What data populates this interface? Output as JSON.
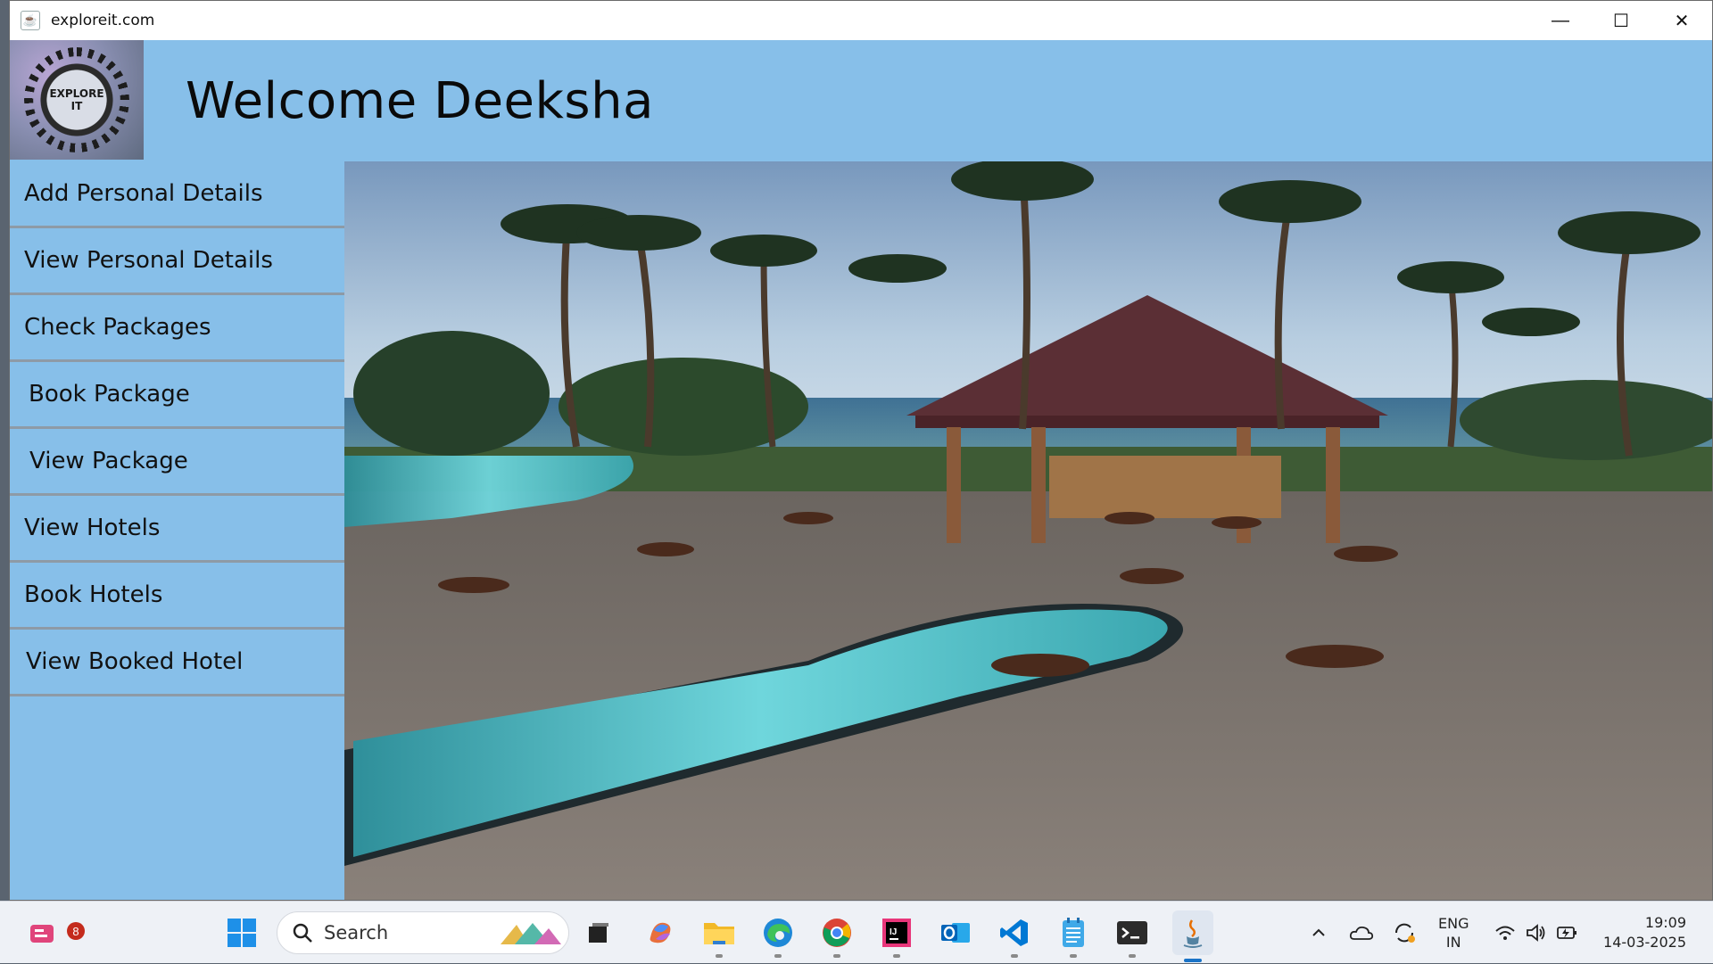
{
  "window": {
    "title": "exploreit.com",
    "minimize_glyph": "—",
    "maximize_glyph": "☐",
    "close_glyph": "✕"
  },
  "header": {
    "logo_text_line1": "EXPLORE",
    "logo_text_line2": "IT",
    "welcome": "Welcome Deeksha"
  },
  "sidebar": {
    "items": [
      {
        "label": "Add Personal Details"
      },
      {
        "label": "View Personal Details"
      },
      {
        "label": "Check Packages"
      },
      {
        "label": "Book Package"
      },
      {
        "label": "View Package"
      },
      {
        "label": "View Hotels"
      },
      {
        "label": "Book Hotels"
      },
      {
        "label": "View Booked Hotel"
      }
    ]
  },
  "hero": {
    "image": "beach-resort-pool-photo",
    "colors": {
      "sky": "#a8c2da",
      "sea": "#3f6f7d",
      "pool": "#5fd0d8",
      "roof": "#5b2f35"
    }
  },
  "taskbar": {
    "widgets_badge": "8",
    "search_placeholder": "Search",
    "apps": [
      "start-icon",
      "search-icon",
      "task-view-icon",
      "copilot-icon",
      "file-explorer-icon",
      "edge-icon",
      "chrome-icon",
      "intellij-icon",
      "outlook-icon",
      "vscode-icon",
      "notepad-icon",
      "terminal-icon",
      "java-icon"
    ],
    "language_line1": "ENG",
    "language_line2": "IN",
    "time": "19:09",
    "date": "14-03-2025"
  },
  "colors": {
    "app_background": "#87bfe9",
    "menu_divider": "#8e9aa6",
    "taskbar": "#eef1f6"
  }
}
